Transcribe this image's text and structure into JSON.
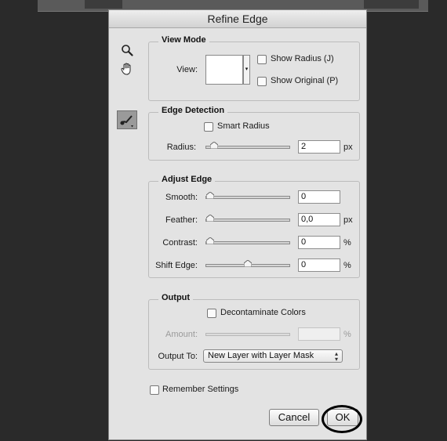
{
  "dialog": {
    "title": "Refine Edge",
    "tools": {
      "zoom": "magnifier-icon",
      "hand": "hand-icon",
      "refine_brush": "refine-radius-brush-icon"
    }
  },
  "view_mode": {
    "heading": "View Mode",
    "view_label": "View:",
    "show_radius": {
      "label": "Show Radius (J)",
      "checked": false
    },
    "show_original": {
      "label": "Show Original (P)",
      "checked": false
    }
  },
  "edge_detection": {
    "heading": "Edge Detection",
    "smart_radius": {
      "label": "Smart Radius",
      "checked": false
    },
    "radius": {
      "label": "Radius:",
      "value": "2",
      "unit": "px",
      "slider_fraction": 0.05
    }
  },
  "adjust_edge": {
    "heading": "Adjust Edge",
    "rows": [
      {
        "label": "Smooth:",
        "value": "0",
        "unit": "",
        "slider_fraction": 0.0
      },
      {
        "label": "Feather:",
        "value": "0,0",
        "unit": "px",
        "slider_fraction": 0.0
      },
      {
        "label": "Contrast:",
        "value": "0",
        "unit": "%",
        "slider_fraction": 0.0
      },
      {
        "label": "Shift Edge:",
        "value": "0",
        "unit": "%",
        "slider_fraction": 0.5
      }
    ]
  },
  "output": {
    "heading": "Output",
    "decontaminate": {
      "label": "Decontaminate Colors",
      "checked": false
    },
    "amount": {
      "label": "Amount:",
      "value": "",
      "unit": "%",
      "disabled": true
    },
    "output_to": {
      "label": "Output To:",
      "selected": "New Layer with Layer Mask"
    }
  },
  "remember": {
    "label": "Remember Settings",
    "checked": false
  },
  "buttons": {
    "cancel": "Cancel",
    "ok": "OK"
  }
}
